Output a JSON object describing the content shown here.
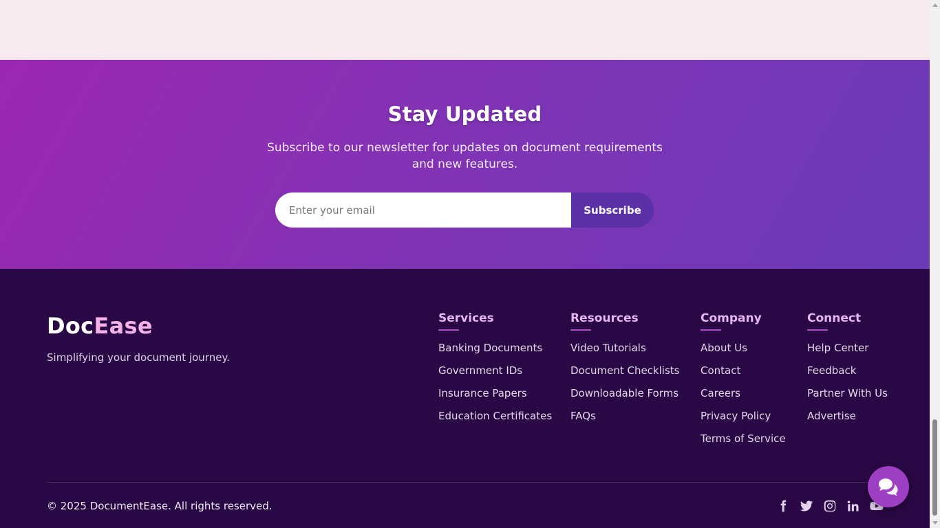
{
  "newsletter": {
    "title": "Stay Updated",
    "description": "Subscribe to our newsletter for updates on document requirements and new features.",
    "email_placeholder": "Enter your email",
    "subscribe_label": "Subscribe"
  },
  "footer": {
    "brand": {
      "part1": "Doc",
      "part2": "Ease"
    },
    "tagline": "Simplifying your document journey.",
    "columns": [
      {
        "title": "Services",
        "links": [
          "Banking Documents",
          "Government IDs",
          "Insurance Papers",
          "Education Certificates"
        ]
      },
      {
        "title": "Resources",
        "links": [
          "Video Tutorials",
          "Document Checklists",
          "Downloadable Forms",
          "FAQs"
        ]
      },
      {
        "title": "Company",
        "links": [
          "About Us",
          "Contact",
          "Careers",
          "Privacy Policy",
          "Terms of Service"
        ]
      },
      {
        "title": "Connect",
        "links": [
          "Help Center",
          "Feedback",
          "Partner With Us",
          "Advertise"
        ]
      }
    ],
    "copyright": "© 2025 DocumentEase. All rights reserved.",
    "socials": [
      "facebook-icon",
      "twitter-icon",
      "instagram-icon",
      "linkedin-icon",
      "youtube-icon"
    ]
  },
  "chat": {
    "icon": "chat-icon"
  },
  "colors": {
    "gradient_start": "#9b27b0",
    "gradient_end": "#6a3ab7",
    "subscribe_button": "#5b2fa6",
    "footer_bg": "#2a0845",
    "brand_accent": "#f3b1e6",
    "heading_accent": "#e5b5ef",
    "chat_button": "#9c3fc2"
  }
}
